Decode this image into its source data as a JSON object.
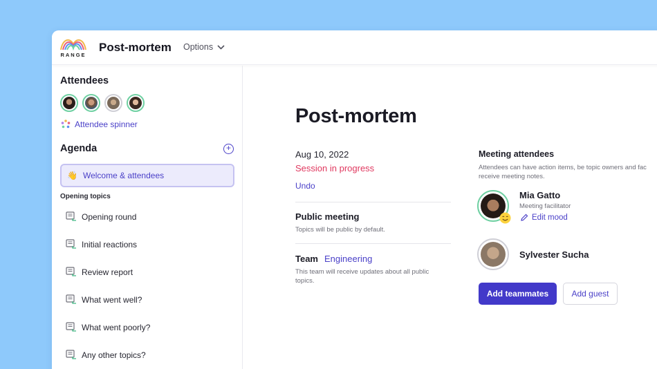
{
  "app": {
    "logo_text": "RANGE",
    "title": "Post-mortem",
    "options_label": "Options"
  },
  "sidebar": {
    "attendees_title": "Attendees",
    "attendees": [
      "attendee-1",
      "attendee-2",
      "attendee-3",
      "attendee-4"
    ],
    "attendee_spinner_label": "Attendee spinner",
    "agenda_title": "Agenda",
    "active_item": {
      "emoji": "👋",
      "label": "Welcome & attendees"
    },
    "opening_topics_label": "Opening topics",
    "topics": [
      "Opening round",
      "Initial reactions",
      "Review report",
      "What went well?",
      "What went poorly?",
      "Any other topics?"
    ]
  },
  "main": {
    "heading": "Post-mortem",
    "date": "Aug 10, 2022",
    "status": "Session in progress",
    "undo_label": "Undo",
    "public_meeting": {
      "title": "Public meeting",
      "description": "Topics will be public by default."
    },
    "team": {
      "label": "Team",
      "value": "Engineering",
      "description": "This team will receive updates about all public topics."
    },
    "meeting_attendees": {
      "title": "Meeting attendees",
      "description_line1": "Attendees can have action items, be topic owners and fac",
      "description_line2": "receive meeting notes.",
      "people": [
        {
          "name": "Mia Gatto",
          "role": "Meeting facilitator",
          "edit_label": "Edit mood"
        },
        {
          "name": "Sylvester Sucha"
        }
      ],
      "add_teammates_label": "Add teammates",
      "add_guest_label": "Add guest"
    }
  },
  "colors": {
    "background": "#8ec9fb",
    "accent": "#4239c9",
    "status_red": "#e0385f",
    "attendee_ring": "#6fd0a2"
  }
}
